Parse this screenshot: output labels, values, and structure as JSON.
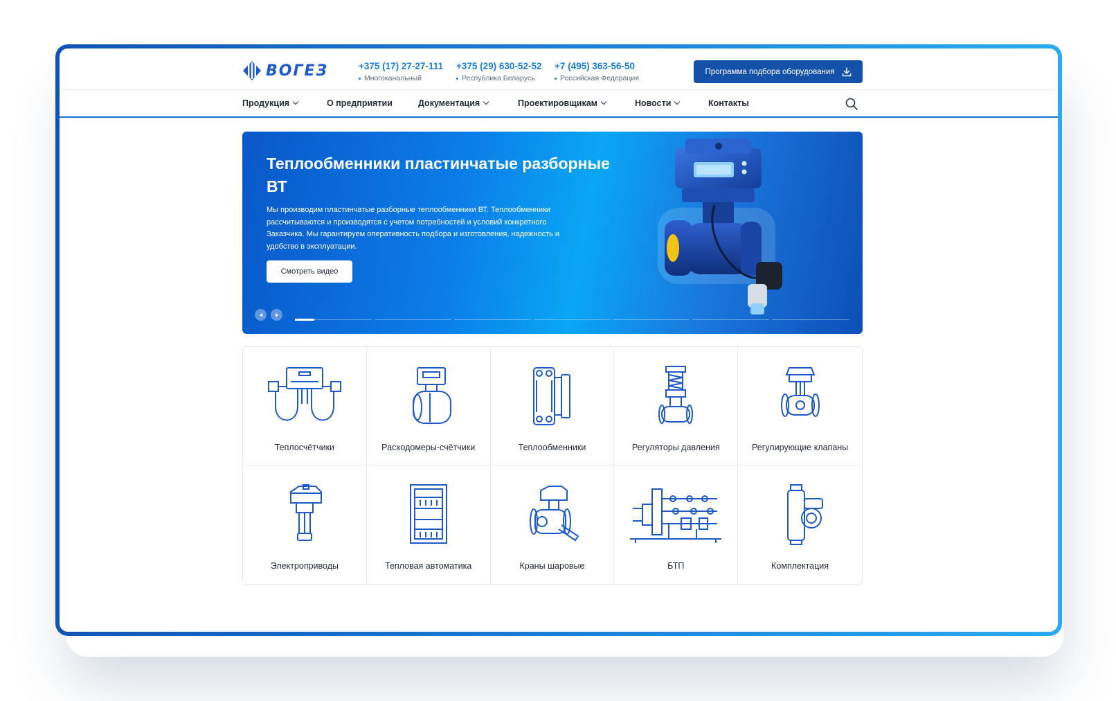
{
  "brand": {
    "logo_text": "ВОГЕЗ",
    "accent": "#1a7ed6",
    "dark_accent": "#1451a8"
  },
  "phones": [
    {
      "number": "+375 (17) 27-27-111",
      "note": "Многоканальный"
    },
    {
      "number": "+375 (29) 630-52-52",
      "note": "Республика Беларусь"
    },
    {
      "number": "+7 (495) 363-56-50",
      "note": "Российская Федерация"
    }
  ],
  "cta": {
    "label": "Программа подбора оборудования",
    "icon": "download-icon"
  },
  "nav": [
    {
      "label": "Продукция",
      "has_dropdown": true
    },
    {
      "label": "О предприятии",
      "has_dropdown": false
    },
    {
      "label": "Документация",
      "has_dropdown": true
    },
    {
      "label": "Проектировщикам",
      "has_dropdown": true
    },
    {
      "label": "Новости",
      "has_dropdown": true
    },
    {
      "label": "Контакты",
      "has_dropdown": false
    }
  ],
  "search": {
    "icon": "search-icon"
  },
  "hero": {
    "title": "Теплообменники пластинчатые разборные ВТ",
    "text": "Мы производим пластинчатые разборные теплообменники ВТ. Теплообменники рассчитываются и производятся с учетом потребностей и условий конкретного Заказчика. Мы гарантируем оперативность подбора и изготовления, надежность и удобство в эксплуатации.",
    "button": "Смотреть видео",
    "slides_total": 7,
    "active_slide": 1
  },
  "categories": [
    {
      "label": "Теплосчётчики",
      "icon": "heat-meter-icon"
    },
    {
      "label": "Расходомеры-счётчики",
      "icon": "flowmeter-icon"
    },
    {
      "label": "Теплообменники",
      "icon": "heat-exchanger-icon"
    },
    {
      "label": "Регуляторы давления",
      "icon": "pressure-regulator-icon"
    },
    {
      "label": "Регулирующие клапаны",
      "icon": "control-valve-icon"
    },
    {
      "label": "Электроприводы",
      "icon": "electric-actuator-icon"
    },
    {
      "label": "Тепловая автоматика",
      "icon": "automation-cabinet-icon"
    },
    {
      "label": "Краны шаровые",
      "icon": "ball-valve-icon"
    },
    {
      "label": "БТП",
      "icon": "heating-unit-icon"
    },
    {
      "label": "Комплектация",
      "icon": "pump-icon"
    }
  ]
}
